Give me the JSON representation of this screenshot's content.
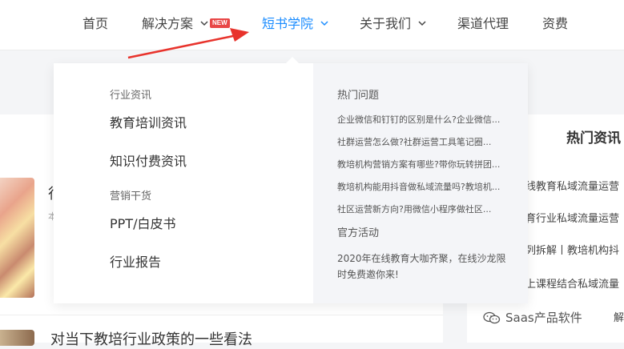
{
  "nav": {
    "items": [
      {
        "label": "首页"
      },
      {
        "label": "解决方案"
      },
      {
        "label": "短书学院"
      },
      {
        "label": "关于我们"
      },
      {
        "label": "渠道代理"
      },
      {
        "label": "资费"
      }
    ],
    "badge": "NEW",
    "active_color": "#1a8cff"
  },
  "dropdown": {
    "groups": [
      {
        "title": "行业资讯",
        "links": [
          "教育培训资讯",
          "知识付费资讯"
        ]
      },
      {
        "title": "营销干货",
        "links": [
          "PPT/白皮书",
          "行业报告"
        ]
      }
    ],
    "hot_title": "热门问题",
    "hot_questions": [
      "企业微信和钉钉的区别是什么?企业微信...",
      "社群运营怎么做?社群运营工具笔记圈...",
      "教培机构营销方案有哪些?带你玩转拼团...",
      "教培机构能用抖音做私域流量吗?教培机...",
      "社区运营新方向?用微信小程序做社区..."
    ],
    "events_title": "官方活动",
    "event_text": "2020年在线教育大咖齐聚，在线沙龙限时免费邀你来!"
  },
  "background": {
    "article_title_1": "行",
    "article_meta_1": "本",
    "article_title_2": "对当下教培行业政策的一些看法",
    "sidebar_title": "热门资讯",
    "sidebar_items": [
      "线教育私域流量运营",
      "育行业私域流量运营",
      "列拆解丨教培机构抖",
      "上课程结合私域流量",
      "解"
    ],
    "watermark": "Saas产品软件"
  }
}
